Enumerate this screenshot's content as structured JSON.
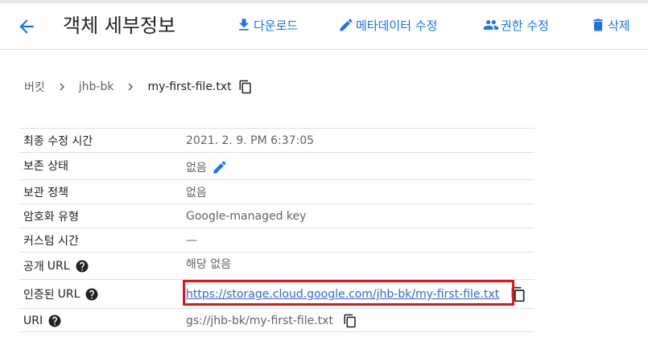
{
  "header": {
    "title": "객체 세부정보",
    "actions": {
      "download": "다운로드",
      "edit_metadata": "메타데이터 수정",
      "edit_permissions": "권한 수정",
      "delete": "삭제"
    },
    "accent": "#1a73e8"
  },
  "breadcrumb": {
    "items": [
      "버킷",
      "jhb-bk",
      "my-first-file.txt"
    ]
  },
  "details": {
    "rows": [
      {
        "label": "최종 수정 시간",
        "value": "2021. 2. 9. PM 6:37:05"
      },
      {
        "label": "보존 상태",
        "value": "없음"
      },
      {
        "label": "보관 정책",
        "value": "없음"
      },
      {
        "label": "암호화 유형",
        "value": "Google-managed key"
      },
      {
        "label": "커스텀 시간",
        "value": "—"
      },
      {
        "label": "공개",
        "label_suffix": "URL",
        "value": "해당 없음"
      },
      {
        "label": "인증된",
        "label_suffix": "URL",
        "value": "https://storage.cloud.google.com/jhb-bk/my-first-file.txt"
      },
      {
        "label": "URI",
        "value": "gs://jhb-bk/my-first-file.txt"
      }
    ]
  },
  "highlight_color": "#e0141e"
}
